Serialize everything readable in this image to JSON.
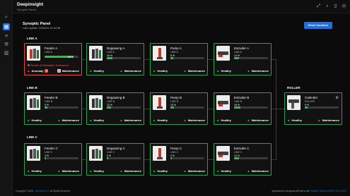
{
  "app": {
    "title": "Deepinsight",
    "subtitle": "Synoptic Panel"
  },
  "header_icons": [
    "expand-icon",
    "bell-icon",
    "bookmark-icon",
    "user-avatar"
  ],
  "avatar_text": "U",
  "rail_icons": [
    "search-icon",
    "grid-icon",
    "list-icon",
    "tools-icon",
    "chart-icon",
    "factory-icon"
  ],
  "panel": {
    "title": "Synoptic Panel",
    "last_update": "Last Update: 15/02/24 10:44:48",
    "reset_button": "Reset Counters"
  },
  "lines": {
    "a": "LINE A",
    "b": "LINE B",
    "c": "LINE C",
    "roller": "ROLLER"
  },
  "status": {
    "healthy": "Healthy",
    "maintenance": "Maintenance",
    "anomaly": "Anomaly"
  },
  "cards": {
    "feeder_a": {
      "name": "Feeder A",
      "line": "LINE A",
      "pct": "85 %",
      "fill": 0.85,
      "alarm": "Feeder 24 Deviation Turbulence",
      "anomaly_count": "3",
      "maint_count": "1"
    },
    "degassing_a": {
      "name": "Degassing A",
      "line": "LINE A",
      "pct": "16 %",
      "fill": 0.16
    },
    "pump_a": {
      "name": "Pump A",
      "line": "LINE A",
      "pct": "8 %",
      "fill": 0.08
    },
    "extruder_a": {
      "name": "Extruder A",
      "line": "LINE A",
      "pct": "14 %",
      "fill": 0.14
    },
    "feeder_b": {
      "name": "Feeder B",
      "line": "LINE B",
      "pct": "9 %",
      "fill": 0.09
    },
    "degassing_b": {
      "name": "Degassing B",
      "line": "LINE B",
      "pct": "13 %",
      "fill": 0.13
    },
    "pump_b": {
      "name": "Pump B",
      "line": "LINE B",
      "pct": "10 %",
      "fill": 0.1
    },
    "extruder_b": {
      "name": "Extruder B",
      "line": "LINE B",
      "pct": "18 %",
      "fill": 0.18
    },
    "calender": {
      "name": "Calender",
      "line": "ROLLER",
      "pct": "9 %",
      "fill": 0.09
    },
    "feeder_c": {
      "name": "Feeder C",
      "line": "LINE C",
      "pct": "4 %",
      "fill": 0.04
    },
    "degassing_c": {
      "name": "Degassing C",
      "line": "LINE C",
      "pct": "5 %",
      "fill": 0.05
    },
    "pump_c": {
      "name": "Pump C",
      "line": "LINE C",
      "pct": "4 %",
      "fill": 0.04
    },
    "extruder_c": {
      "name": "Extruder C",
      "line": "LINE C",
      "pct": "14 %",
      "fill": 0.14
    }
  },
  "footer": {
    "left_prefix": "Copyright © 2025 -",
    "left_link": "NewTech S.r.l.",
    "left_suffix": "All Rights Reserved",
    "right_prefix": "Applicazione sviluppata all'interno del",
    "right_link": "Progetto 'Ricerca INNOT 2022-2023'"
  },
  "colors": {
    "accent": "#1f6fe0",
    "healthy": "#27a24a",
    "alarm": "#e34848"
  }
}
